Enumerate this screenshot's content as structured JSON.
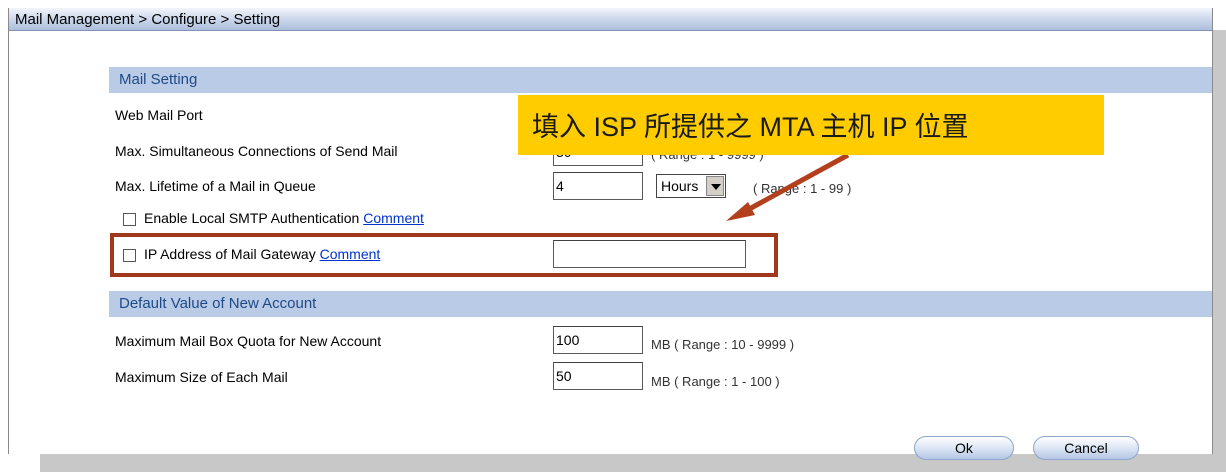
{
  "breadcrumb": "Mail Management > Configure > Setting",
  "mail_setting": {
    "header": "Mail Setting",
    "web_mail_port_label": "Web Mail Port",
    "max_connections_label": "Max. Simultaneous Connections of Send Mail",
    "max_connections_value": "30",
    "max_connections_range": "( Range : 1 - 9999 )",
    "lifetime_label": "Max. Lifetime of a Mail in Queue",
    "lifetime_value": "4",
    "lifetime_unit": "Hours",
    "lifetime_range": "( Range : 1 - 99 )",
    "smtp_auth_label": "Enable Local SMTP Authentication",
    "smtp_auth_link": "Comment",
    "smtp_auth_checked": false,
    "gateway_label": "IP Address of Mail Gateway",
    "gateway_link": "Comment",
    "gateway_checked": false,
    "gateway_value": ""
  },
  "default_account": {
    "header": "Default Value of New Account",
    "quota_label": "Maximum Mail Box Quota for New Account",
    "quota_value": "100",
    "quota_range": "MB ( Range : 10 - 9999 )",
    "max_size_label": "Maximum Size of Each Mail",
    "max_size_value": "50",
    "max_size_range": "MB ( Range : 1 - 100 )"
  },
  "callout_text": "填入 ISP 所提供之 MTA 主机 IP 位置",
  "buttons": {
    "ok": "Ok",
    "cancel": "Cancel"
  },
  "colors": {
    "highlight_border": "#a0381c",
    "callout_bg": "#ffcc00",
    "section_bg": "#b9cbe6"
  }
}
